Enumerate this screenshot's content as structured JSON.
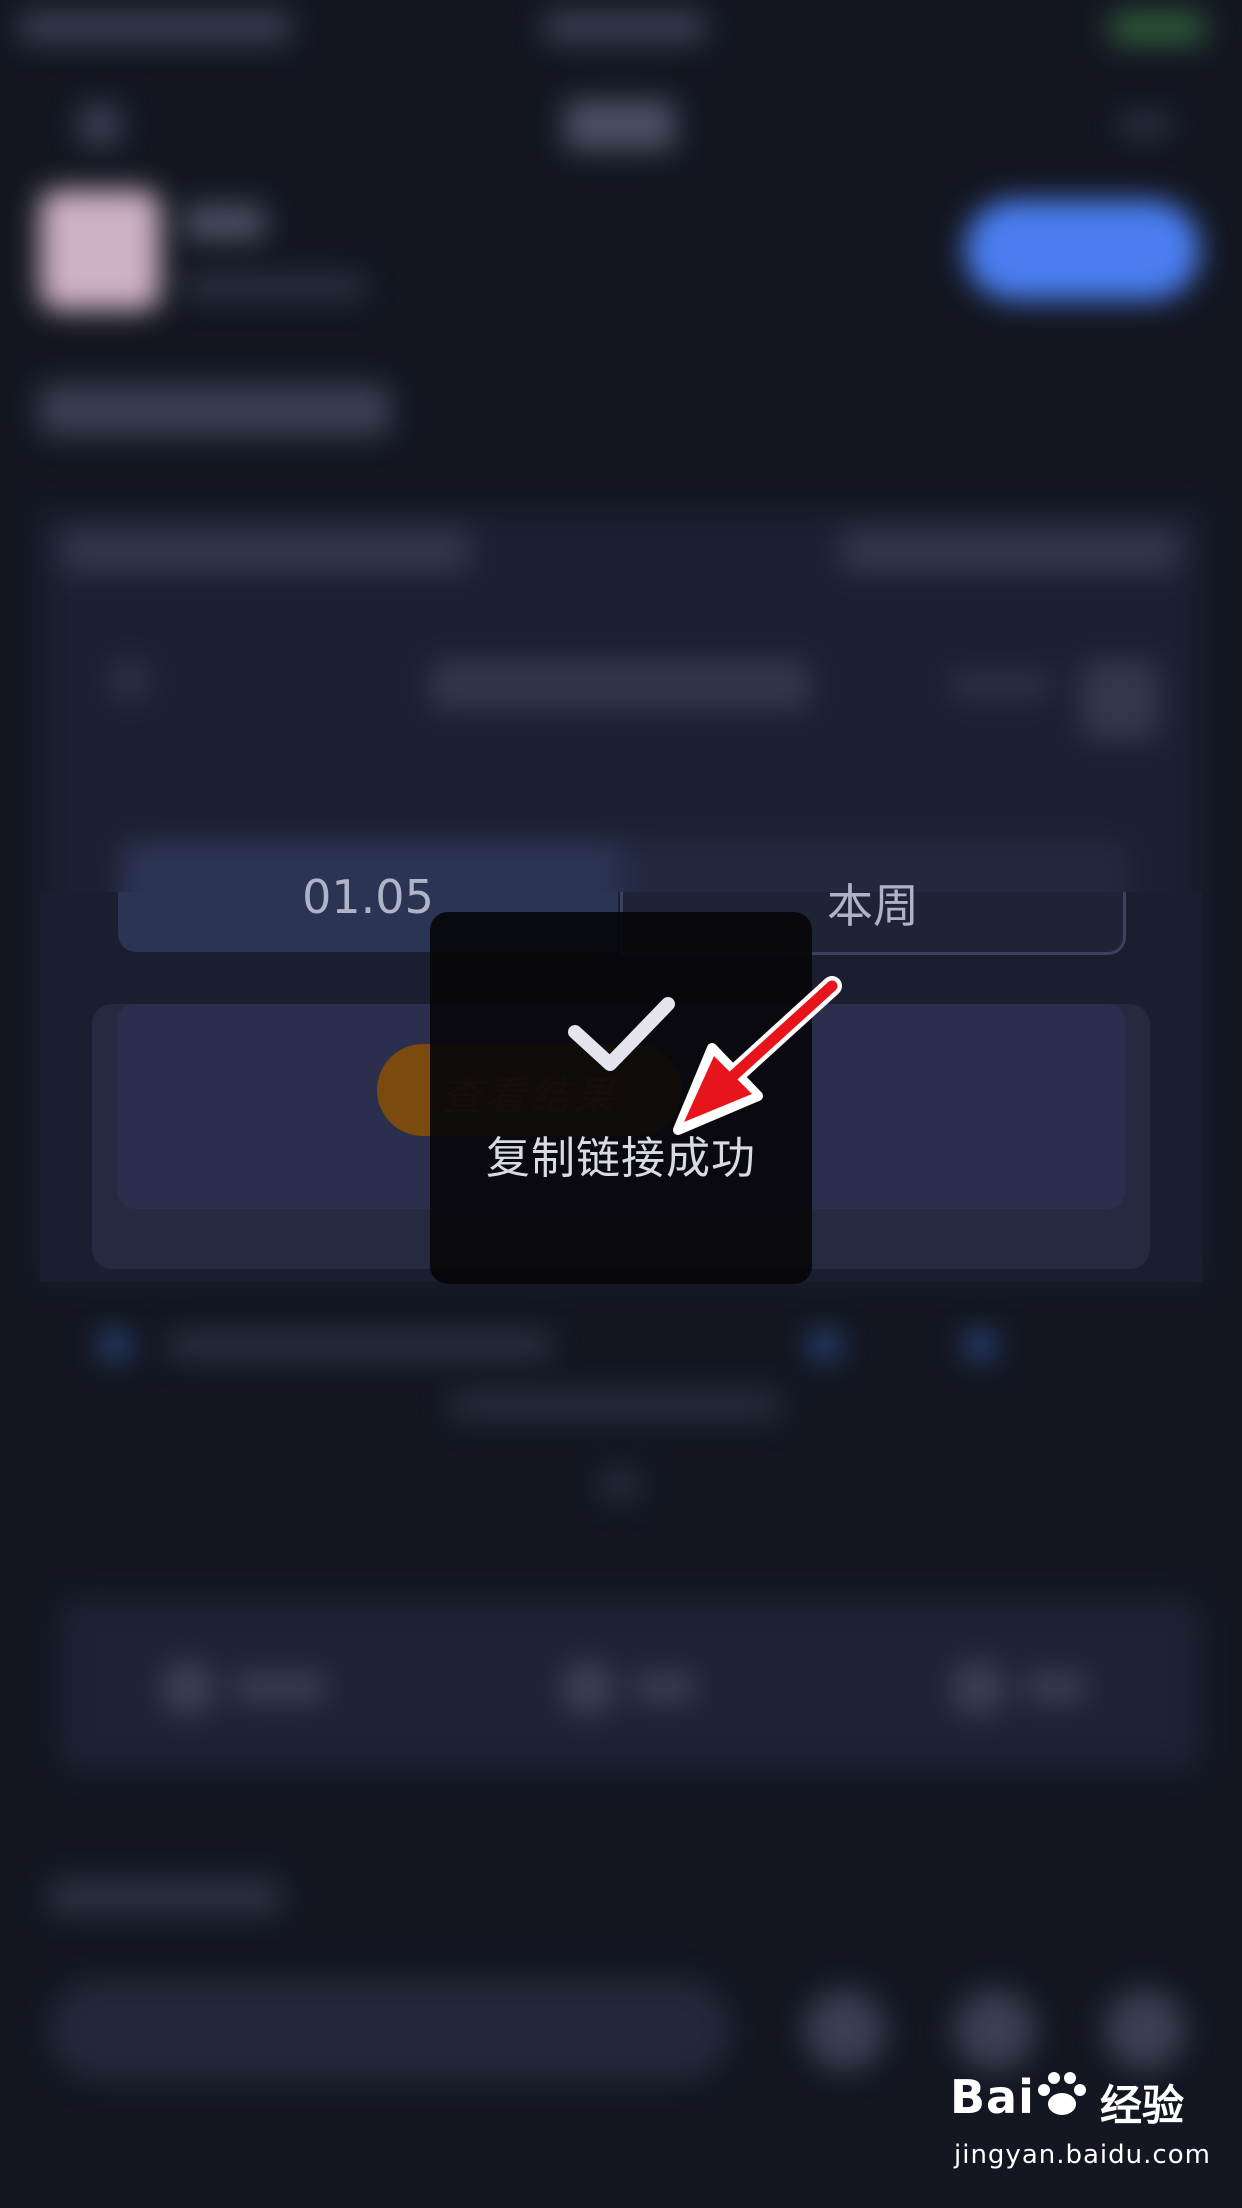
{
  "background": {
    "date_value": "01.05",
    "period_value": "本周",
    "action_button_label": "查看结果"
  },
  "toast": {
    "message": "复制链接成功",
    "icon": "check-icon"
  },
  "annotation": {
    "arrow_color": "#e8141c"
  },
  "watermark": {
    "brand": "Bai",
    "brand_cn": "经验",
    "url": "jingyan.baidu.com"
  },
  "colors": {
    "background": "#141722",
    "accent_blue": "#4a7ef0",
    "button_orange": "#7a4a0e"
  }
}
